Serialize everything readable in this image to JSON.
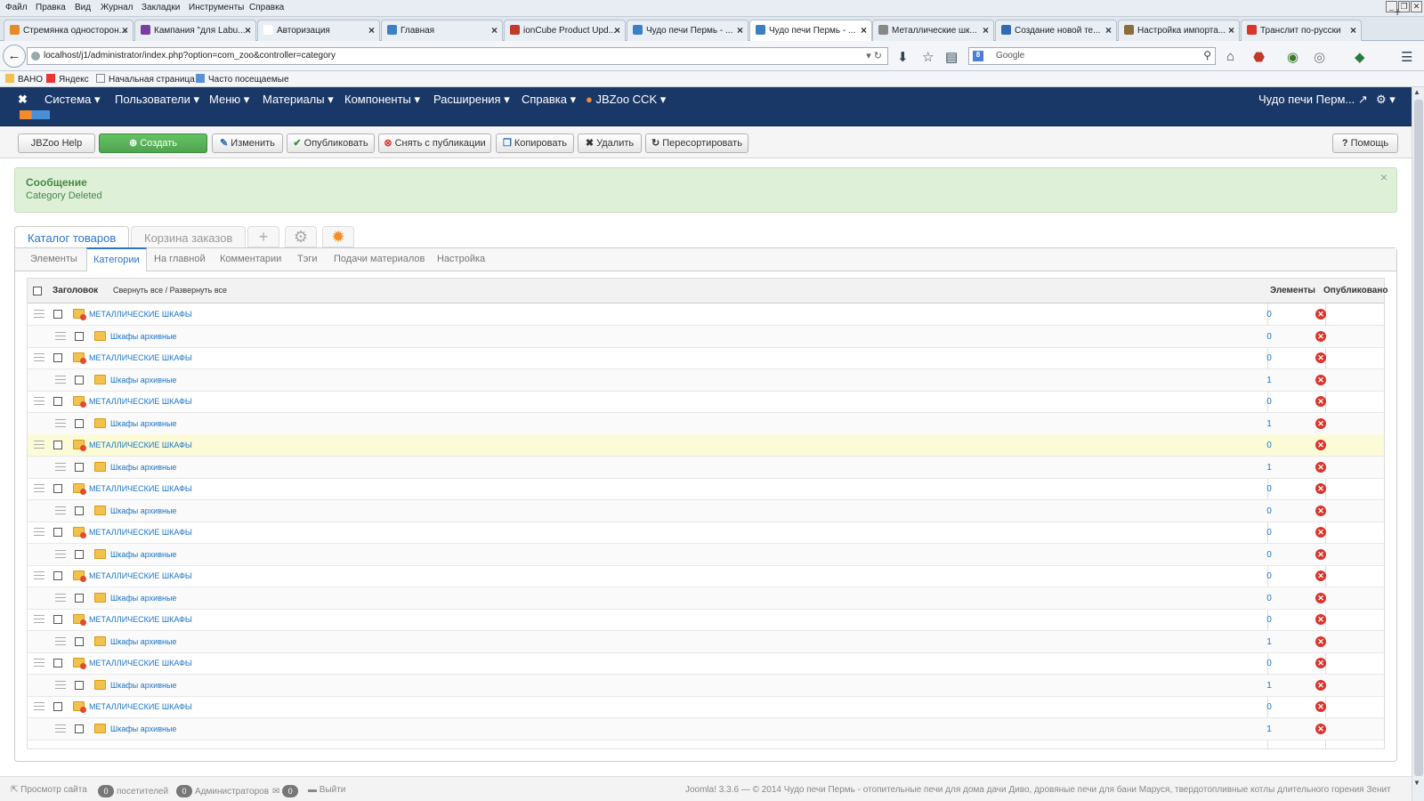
{
  "browser": {
    "menu": [
      "Файл",
      "Правка",
      "Вид",
      "Журнал",
      "Закладки",
      "Инструменты",
      "Справка"
    ],
    "tabs": [
      {
        "label": "Стремянка односторон...",
        "color": "#e58b2a"
      },
      {
        "label": "Кампания \"для Labu...",
        "color": "#7a3ea3"
      },
      {
        "label": "Авторизация",
        "color": "#ffffff"
      },
      {
        "label": "Главная",
        "color": "#3b7fc4"
      },
      {
        "label": "ionCube Product Upd...",
        "color": "#c0392b"
      },
      {
        "label": "Чудо печи Пермь - ...",
        "color": "#3b7fc4"
      },
      {
        "label": "Чудо печи Пермь - ...",
        "color": "#3b7fc4"
      },
      {
        "label": "Металлические шк...",
        "color": "#888888"
      },
      {
        "label": "Создание новой те...",
        "color": "#2f6bb3"
      },
      {
        "label": "Настройка импорта...",
        "color": "#8a6d3b"
      },
      {
        "label": "Транслит по-русски",
        "color": "#d9352b"
      }
    ],
    "url": "localhost/j1/administrator/index.php?option=com_zoo&controller=category",
    "search_placeholder": "Google",
    "bookmarks": [
      "ВАНО",
      "Яндекс",
      "Начальная страница",
      "Часто посещаемые"
    ]
  },
  "admin_menu": {
    "items": [
      "Система",
      "Пользователи",
      "Меню",
      "Материалы",
      "Компоненты",
      "Расширения",
      "Справка",
      "JBZoo CCK"
    ],
    "site_name": "Чудо печи Перм..."
  },
  "toolbar": {
    "jbzoo_help": "JBZoo Help",
    "create": "Создать",
    "edit": "Изменить",
    "publish": "Опубликовать",
    "unpublish": "Снять с публикации",
    "copy": "Копировать",
    "delete": "Удалить",
    "rebuild": "Пересортировать",
    "help": "Помощь"
  },
  "message": {
    "heading": "Сообщение",
    "body": "Category Deleted"
  },
  "app_tabs": {
    "catalog": "Каталог товаров",
    "cart": "Корзина заказов"
  },
  "sub_tabs": [
    "Элементы",
    "Категории",
    "На главной",
    "Комментарии",
    "Тэги",
    "Подачи материалов",
    "Настройка"
  ],
  "grid": {
    "col_title": "Заголовок",
    "collapse_expand": "Свернуть все / Развернуть все",
    "col_elements": "Элементы",
    "col_published": "Опубликовано",
    "rows": [
      {
        "title": "МЕТАЛЛИЧЕСКИЕ ШКАФЫ",
        "elements": "0",
        "level": 0
      },
      {
        "title": "Шкафы архивные",
        "elements": "0",
        "level": 1
      },
      {
        "title": "МЕТАЛЛИЧЕСКИЕ ШКАФЫ",
        "elements": "0",
        "level": 0
      },
      {
        "title": "Шкафы архивные",
        "elements": "1",
        "level": 1
      },
      {
        "title": "МЕТАЛЛИЧЕСКИЕ ШКАФЫ",
        "elements": "0",
        "level": 0
      },
      {
        "title": "Шкафы архивные",
        "elements": "1",
        "level": 1
      },
      {
        "title": "МЕТАЛЛИЧЕСКИЕ ШКАФЫ",
        "elements": "0",
        "level": 0
      },
      {
        "title": "Шкафы архивные",
        "elements": "1",
        "level": 1
      },
      {
        "title": "МЕТАЛЛИЧЕСКИЕ ШКАФЫ",
        "elements": "0",
        "level": 0
      },
      {
        "title": "Шкафы архивные",
        "elements": "0",
        "level": 1
      },
      {
        "title": "МЕТАЛЛИЧЕСКИЕ ШКАФЫ",
        "elements": "0",
        "level": 0
      },
      {
        "title": "Шкафы архивные",
        "elements": "0",
        "level": 1
      },
      {
        "title": "МЕТАЛЛИЧЕСКИЕ ШКАФЫ",
        "elements": "0",
        "level": 0
      },
      {
        "title": "Шкафы архивные",
        "elements": "0",
        "level": 1
      },
      {
        "title": "МЕТАЛЛИЧЕСКИЕ ШКАФЫ",
        "elements": "0",
        "level": 0
      },
      {
        "title": "Шкафы архивные",
        "elements": "1",
        "level": 1
      },
      {
        "title": "МЕТАЛЛИЧЕСКИЕ ШКАФЫ",
        "elements": "0",
        "level": 0
      },
      {
        "title": "Шкафы архивные",
        "elements": "1",
        "level": 1
      },
      {
        "title": "МЕТАЛЛИЧЕСКИЕ ШКАФЫ",
        "elements": "0",
        "level": 0
      },
      {
        "title": "Шкафы архивные",
        "elements": "1",
        "level": 1
      }
    ]
  },
  "footer": {
    "view_site": "Просмотр сайта",
    "visitors_count": "0",
    "visitors_label": "посетителей",
    "admins_count": "0",
    "admins_label": "Администраторов",
    "messages_count": "0",
    "logout": "Выйти",
    "copyright": "Joomla! 3.3.6 — © 2014 Чудо печи Пермь - отопительные печи для дома дачи Диво, дровяные печи для бани Маруся, твердотопливные котлы длительного горения Зенит"
  },
  "colors": {
    "admin_bar": "#1a3867",
    "success_bg": "#dff0d8",
    "link": "#1b74c5",
    "create_btn": "#51a351"
  }
}
